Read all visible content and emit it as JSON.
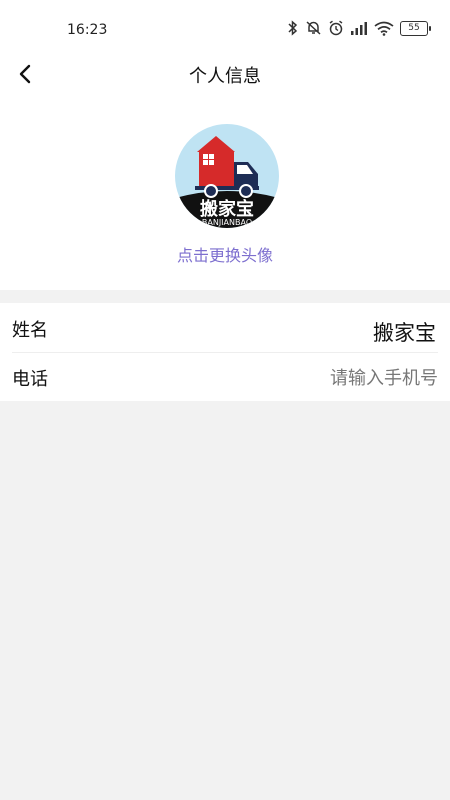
{
  "status_bar": {
    "time": "16:23",
    "battery": "55",
    "icons": [
      "bluetooth-icon",
      "mute-bell-icon",
      "alarm-icon",
      "signal-icon",
      "wifi-icon",
      "battery-icon"
    ]
  },
  "header": {
    "title": "个人信息",
    "back_icon": "chevron-left-icon"
  },
  "avatar": {
    "logo_text": "搬家宝",
    "logo_subtext": "BANJIANBAO",
    "change_label": "点击更换头像"
  },
  "form": {
    "name_label": "姓名",
    "name_value": "搬家宝",
    "phone_label": "电话",
    "phone_placeholder": "请输入手机号",
    "phone_value": ""
  },
  "colors": {
    "accent": "#7d6fcf",
    "avatar_bg": "#bfe3f3",
    "truck_red": "#d62a2a",
    "truck_navy": "#1e2d55"
  }
}
